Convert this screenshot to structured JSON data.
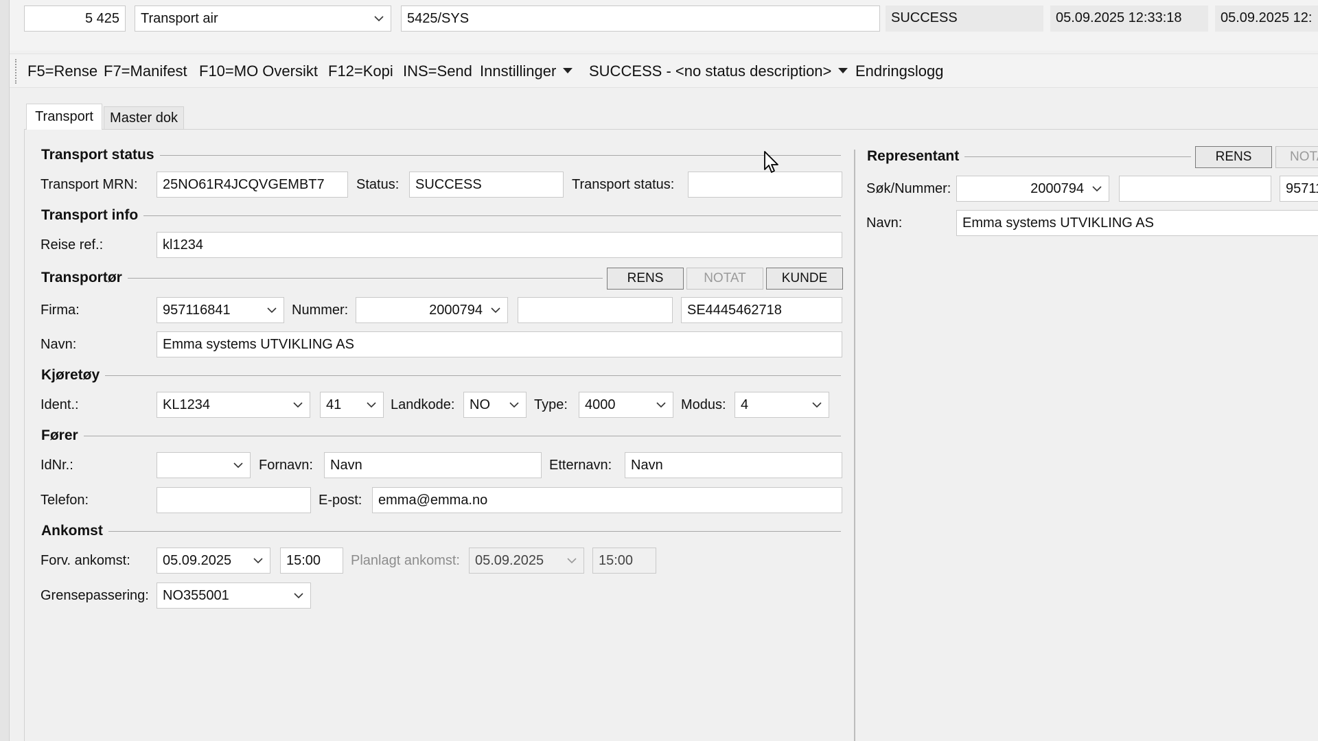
{
  "header": {
    "number": "5 425",
    "transport_type": "Transport air",
    "reference": "5425/SYS",
    "status": "SUCCESS",
    "created": "05.09.2025 12:33:18",
    "modified": "05.09.2025 12:"
  },
  "toolbar": {
    "items": [
      "F5=Rense",
      "F7=Manifest",
      "F10=MO Oversikt",
      "F12=Kopi",
      "INS=Send"
    ],
    "settings": "Innstillinger",
    "status_menu": "SUCCESS - <no status description>",
    "changelog": "Endringslogg"
  },
  "tabs": [
    {
      "label": "Transport",
      "selected": true
    },
    {
      "label": "Master dok",
      "selected": false
    }
  ],
  "transport_status": {
    "title": "Transport status",
    "mrn_label": "Transport MRN:",
    "mrn": "25NO61R4JCQVGEMBT7",
    "status_label": "Status:",
    "status": "SUCCESS",
    "transport_status_label": "Transport status:",
    "transport_status": ""
  },
  "transport_info": {
    "title": "Transport info",
    "reise_ref_label": "Reise ref.:",
    "reise_ref": "kl1234"
  },
  "transportor": {
    "title": "Transportør",
    "btn_rens": "RENS",
    "btn_notat": "NOTAT",
    "btn_kunde": "KUNDE",
    "firma_label": "Firma:",
    "firma": "957116841",
    "nummer_label": "Nummer:",
    "nummer": "2000794",
    "extra": "",
    "vat": "SE4445462718",
    "navn_label": "Navn:",
    "navn": "Emma systems UTVIKLING AS"
  },
  "kjoretoy": {
    "title": "Kjøretøy",
    "ident_label": "Ident.:",
    "ident": "KL1234",
    "ident_nr": "41",
    "landkode_label": "Landkode:",
    "landkode": "NO",
    "type_label": "Type:",
    "type": "4000",
    "modus_label": "Modus:",
    "modus": "4"
  },
  "forer": {
    "title": "Fører",
    "idnr_label": "IdNr.:",
    "idnr": "",
    "fornavn_label": "Fornavn:",
    "fornavn": "Navn",
    "etternavn_label": "Etternavn:",
    "etternavn": "Navn",
    "telefon_label": "Telefon:",
    "telefon": "",
    "epost_label": "E-post:",
    "epost": "emma@emma.no"
  },
  "ankomst": {
    "title": "Ankomst",
    "forv_label": "Forv. ankomst:",
    "forv_date": "05.09.2025",
    "forv_time": "15:00",
    "planlagt_label": "Planlagt ankomst:",
    "planlagt_date": "05.09.2025",
    "planlagt_time": "15:00",
    "grense_label": "Grensepassering:",
    "grense": "NO355001"
  },
  "representant": {
    "title": "Representant",
    "btn_rens": "RENS",
    "btn_notat": "NOTA",
    "sok_label": "Søk/Nummer:",
    "nummer": "2000794",
    "extra": "",
    "org": "95711",
    "navn_label": "Navn:",
    "navn": "Emma systems UTVIKLING AS"
  }
}
